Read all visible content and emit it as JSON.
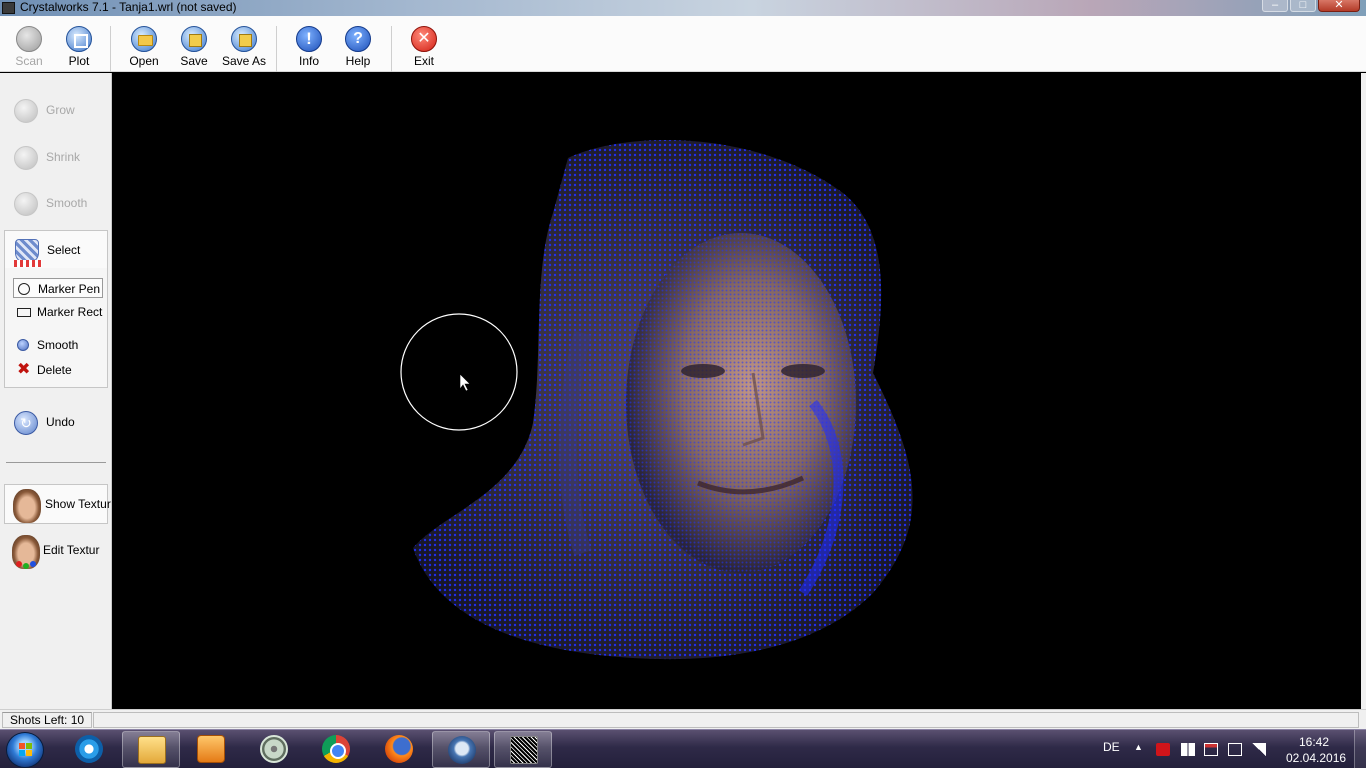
{
  "window": {
    "title": "Crystalworks 7.1 - Tanja1.wrl  (not saved)",
    "controls": {
      "minimize": "‒",
      "maximize": "□",
      "close": "✕"
    }
  },
  "toolbar": {
    "scan": "Scan",
    "plot": "Plot",
    "open": "Open",
    "save": "Save",
    "save_as": "Save As",
    "info": "Info",
    "help": "Help",
    "exit": "Exit",
    "info_glyph": "!",
    "help_glyph": "?",
    "exit_glyph": "✕"
  },
  "sidebar": {
    "grow": "Grow",
    "shrink": "Shrink",
    "smooth": "Smooth",
    "select": "Select",
    "select_tools": {
      "marker_pen": "Marker Pen",
      "marker_rect": "Marker Rect",
      "smooth": "Smooth",
      "delete": "Delete",
      "delete_glyph": "✖"
    },
    "undo": "Undo",
    "undo_glyph": "↻",
    "show_texture": "Show Textur",
    "edit_texture": "Edit Textur"
  },
  "viewport": {
    "background": "#000000",
    "point_color": "#1f2cff",
    "cursor_circle_color": "#ffffff"
  },
  "statusbar": {
    "shots_left": "Shots Left: 10"
  },
  "taskbar": {
    "apps": [
      "windows-explorer-icon",
      "internet-explorer-icon",
      "file-explorer-icon",
      "media-player-icon",
      "disc-icon",
      "chrome-icon",
      "firefox-icon",
      "thunderbird-icon",
      "crystalworks-icon"
    ],
    "language": "DE",
    "tray_arrow": "▲",
    "time": "16:42",
    "date": "02.04.2016"
  }
}
